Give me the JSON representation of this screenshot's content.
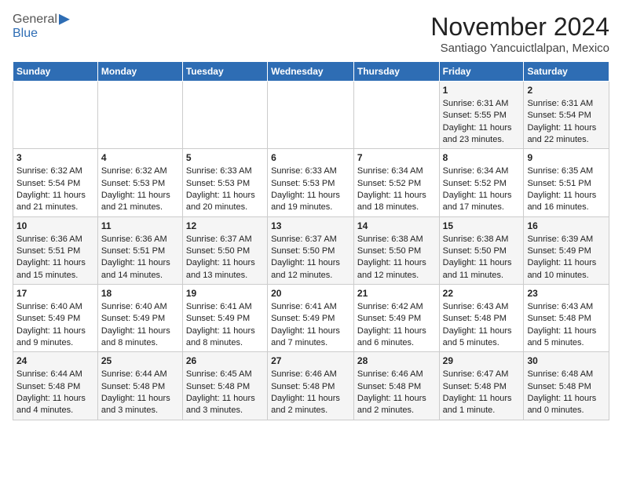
{
  "header": {
    "logo_general": "General",
    "logo_blue": "Blue",
    "title": "November 2024",
    "subtitle": "Santiago Yancuictlalpan, Mexico"
  },
  "days_of_week": [
    "Sunday",
    "Monday",
    "Tuesday",
    "Wednesday",
    "Thursday",
    "Friday",
    "Saturday"
  ],
  "weeks": [
    [
      {
        "day": "",
        "empty": true
      },
      {
        "day": "",
        "empty": true
      },
      {
        "day": "",
        "empty": true
      },
      {
        "day": "",
        "empty": true
      },
      {
        "day": "",
        "empty": true
      },
      {
        "day": "1",
        "sunrise": "6:31 AM",
        "sunset": "5:55 PM",
        "daylight": "11 hours and 23 minutes."
      },
      {
        "day": "2",
        "sunrise": "6:31 AM",
        "sunset": "5:54 PM",
        "daylight": "11 hours and 22 minutes."
      }
    ],
    [
      {
        "day": "3",
        "sunrise": "6:32 AM",
        "sunset": "5:54 PM",
        "daylight": "11 hours and 21 minutes."
      },
      {
        "day": "4",
        "sunrise": "6:32 AM",
        "sunset": "5:53 PM",
        "daylight": "11 hours and 21 minutes."
      },
      {
        "day": "5",
        "sunrise": "6:33 AM",
        "sunset": "5:53 PM",
        "daylight": "11 hours and 20 minutes."
      },
      {
        "day": "6",
        "sunrise": "6:33 AM",
        "sunset": "5:53 PM",
        "daylight": "11 hours and 19 minutes."
      },
      {
        "day": "7",
        "sunrise": "6:34 AM",
        "sunset": "5:52 PM",
        "daylight": "11 hours and 18 minutes."
      },
      {
        "day": "8",
        "sunrise": "6:34 AM",
        "sunset": "5:52 PM",
        "daylight": "11 hours and 17 minutes."
      },
      {
        "day": "9",
        "sunrise": "6:35 AM",
        "sunset": "5:51 PM",
        "daylight": "11 hours and 16 minutes."
      }
    ],
    [
      {
        "day": "10",
        "sunrise": "6:36 AM",
        "sunset": "5:51 PM",
        "daylight": "11 hours and 15 minutes."
      },
      {
        "day": "11",
        "sunrise": "6:36 AM",
        "sunset": "5:51 PM",
        "daylight": "11 hours and 14 minutes."
      },
      {
        "day": "12",
        "sunrise": "6:37 AM",
        "sunset": "5:50 PM",
        "daylight": "11 hours and 13 minutes."
      },
      {
        "day": "13",
        "sunrise": "6:37 AM",
        "sunset": "5:50 PM",
        "daylight": "11 hours and 12 minutes."
      },
      {
        "day": "14",
        "sunrise": "6:38 AM",
        "sunset": "5:50 PM",
        "daylight": "11 hours and 12 minutes."
      },
      {
        "day": "15",
        "sunrise": "6:38 AM",
        "sunset": "5:50 PM",
        "daylight": "11 hours and 11 minutes."
      },
      {
        "day": "16",
        "sunrise": "6:39 AM",
        "sunset": "5:49 PM",
        "daylight": "11 hours and 10 minutes."
      }
    ],
    [
      {
        "day": "17",
        "sunrise": "6:40 AM",
        "sunset": "5:49 PM",
        "daylight": "11 hours and 9 minutes."
      },
      {
        "day": "18",
        "sunrise": "6:40 AM",
        "sunset": "5:49 PM",
        "daylight": "11 hours and 8 minutes."
      },
      {
        "day": "19",
        "sunrise": "6:41 AM",
        "sunset": "5:49 PM",
        "daylight": "11 hours and 8 minutes."
      },
      {
        "day": "20",
        "sunrise": "6:41 AM",
        "sunset": "5:49 PM",
        "daylight": "11 hours and 7 minutes."
      },
      {
        "day": "21",
        "sunrise": "6:42 AM",
        "sunset": "5:49 PM",
        "daylight": "11 hours and 6 minutes."
      },
      {
        "day": "22",
        "sunrise": "6:43 AM",
        "sunset": "5:48 PM",
        "daylight": "11 hours and 5 minutes."
      },
      {
        "day": "23",
        "sunrise": "6:43 AM",
        "sunset": "5:48 PM",
        "daylight": "11 hours and 5 minutes."
      }
    ],
    [
      {
        "day": "24",
        "sunrise": "6:44 AM",
        "sunset": "5:48 PM",
        "daylight": "11 hours and 4 minutes."
      },
      {
        "day": "25",
        "sunrise": "6:44 AM",
        "sunset": "5:48 PM",
        "daylight": "11 hours and 3 minutes."
      },
      {
        "day": "26",
        "sunrise": "6:45 AM",
        "sunset": "5:48 PM",
        "daylight": "11 hours and 3 minutes."
      },
      {
        "day": "27",
        "sunrise": "6:46 AM",
        "sunset": "5:48 PM",
        "daylight": "11 hours and 2 minutes."
      },
      {
        "day": "28",
        "sunrise": "6:46 AM",
        "sunset": "5:48 PM",
        "daylight": "11 hours and 2 minutes."
      },
      {
        "day": "29",
        "sunrise": "6:47 AM",
        "sunset": "5:48 PM",
        "daylight": "11 hours and 1 minute."
      },
      {
        "day": "30",
        "sunrise": "6:48 AM",
        "sunset": "5:48 PM",
        "daylight": "11 hours and 0 minutes."
      }
    ]
  ]
}
